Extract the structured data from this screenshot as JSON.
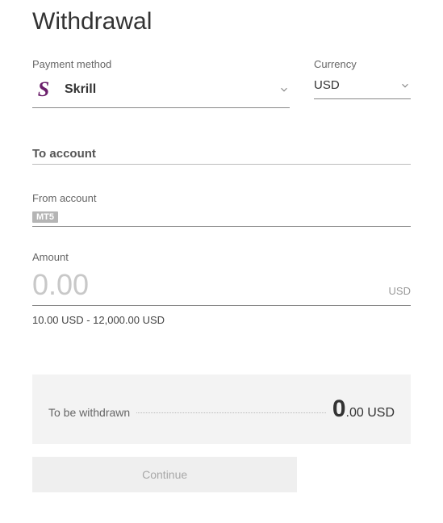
{
  "title": "Withdrawal",
  "payment_method": {
    "label": "Payment method",
    "value": "Skrill",
    "icon_letter": "S"
  },
  "currency": {
    "label": "Currency",
    "value": "USD"
  },
  "to_account": {
    "label": "To account"
  },
  "from_account": {
    "label": "From account",
    "badge": "MT5"
  },
  "amount": {
    "label": "Amount",
    "placeholder": "0.00",
    "currency": "USD",
    "range": "10.00 USD  -  12,000.00 USD"
  },
  "summary": {
    "label": "To be withdrawn",
    "value_int": "0",
    "value_dec": ".00 USD"
  },
  "actions": {
    "continue": "Continue"
  }
}
